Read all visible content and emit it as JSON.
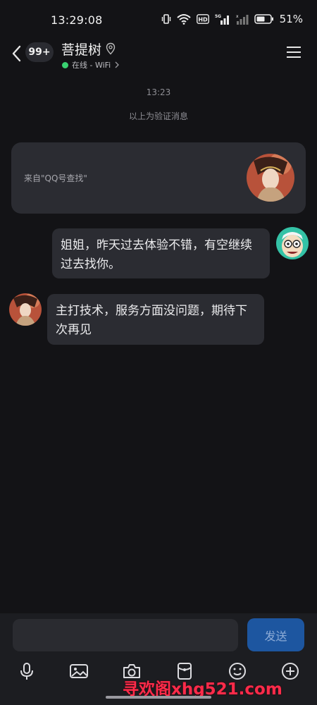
{
  "status_bar": {
    "time": "13:29:08",
    "battery": "51%",
    "network_label": "HD",
    "network_gen": "5G"
  },
  "header": {
    "unread_count": "99+",
    "contact_name": "菩提树",
    "presence": "在线 - WiFi"
  },
  "chat": {
    "timestamp": "13:23",
    "system_notice": "以上为验证消息",
    "source_card": {
      "text": "来自\"QQ号查找\""
    },
    "messages": [
      {
        "direction": "outgoing",
        "text": "姐姐，昨天过去体验不错，有空继续过去找你。"
      },
      {
        "direction": "incoming",
        "text": "主打技术，服务方面没问题，期待下次再见"
      }
    ]
  },
  "composer": {
    "input_value": "",
    "send_label": "发送",
    "tools": [
      "microphone-icon",
      "image-icon",
      "camera-icon",
      "red-packet-icon",
      "emoji-icon",
      "plus-icon"
    ]
  },
  "watermark": "寻欢阁xhg521.com",
  "colors": {
    "background": "#131316",
    "bubble": "#2b2c32",
    "online": "#39d171",
    "send_button": "#1d56a0",
    "watermark": "#ff2b4a"
  }
}
